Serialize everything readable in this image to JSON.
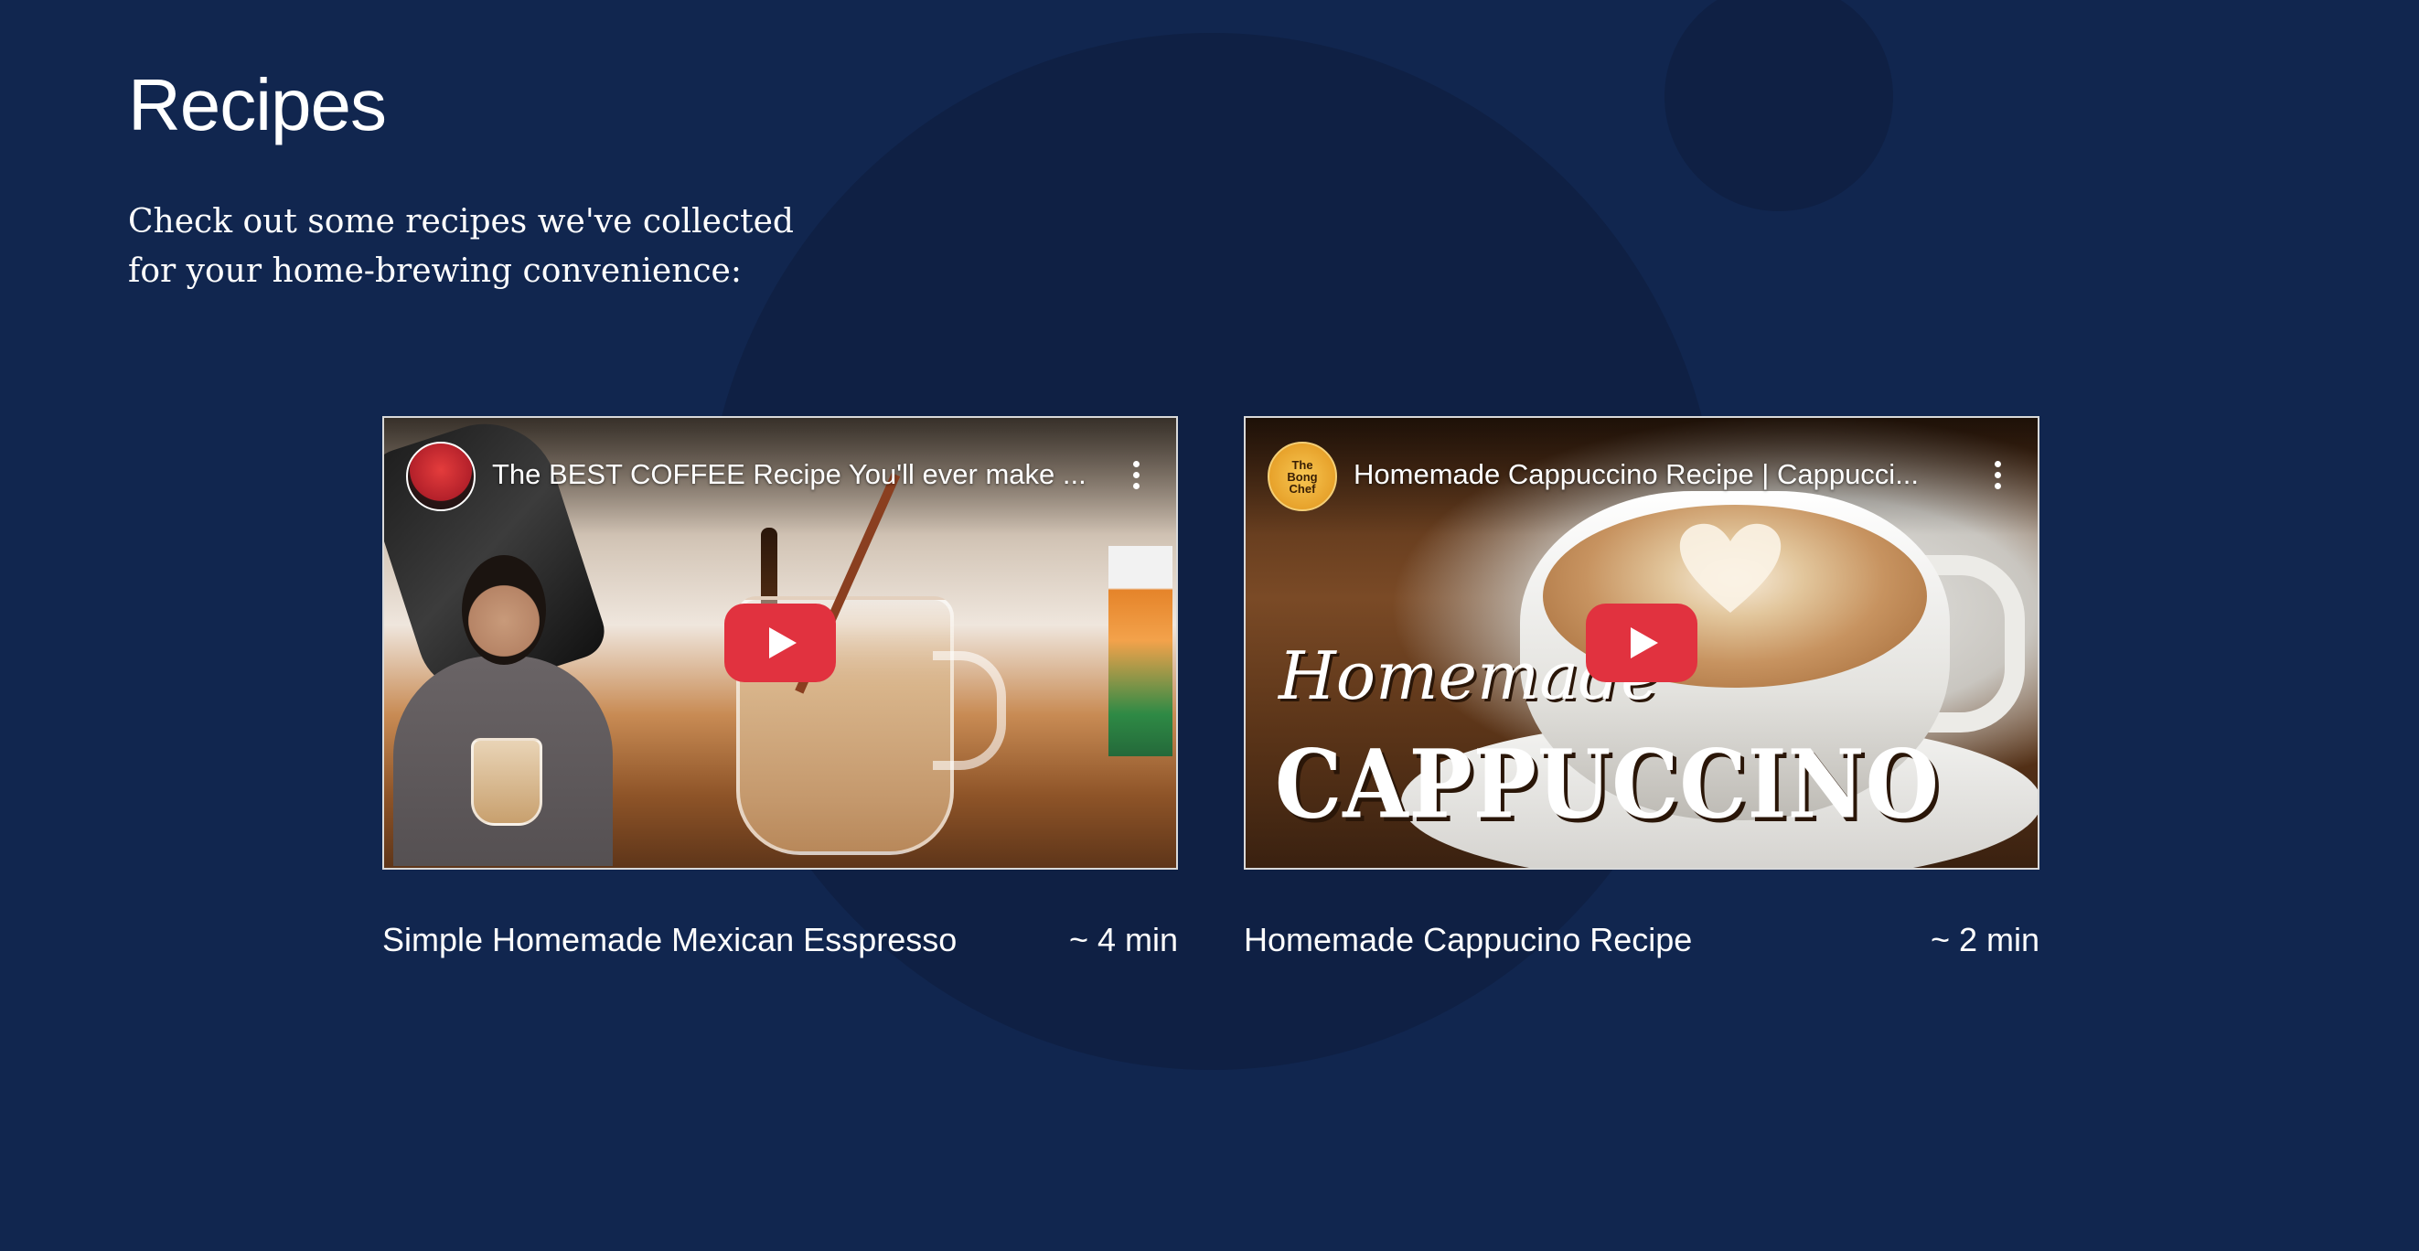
{
  "page": {
    "title": "Recipes",
    "subtitle": "Check out some recipes we've collected for your home-brewing convenience:",
    "background_color": "#11264f",
    "accent_color": "#e1323f"
  },
  "recipes": [
    {
      "video_title": "The BEST COFFEE Recipe You'll ever make ...",
      "channel_icon": "channel-avatar",
      "caption": "Simple Homemade Mexican Esspresso",
      "duration": "~ 4 min"
    },
    {
      "video_title": "Homemade Cappuccino Recipe | Cappucci...",
      "channel_icon": "channel-avatar",
      "channel_logo_text": "The\nBong\nChef",
      "thumbnail_text_line1": "Homemade",
      "thumbnail_text_line2": "CAPPUCCINO",
      "caption": "Homemade Cappucino Recipe",
      "duration": "~ 2 min"
    }
  ],
  "icons": {
    "play": "youtube-play-icon",
    "more": "more-vertical-icon"
  }
}
